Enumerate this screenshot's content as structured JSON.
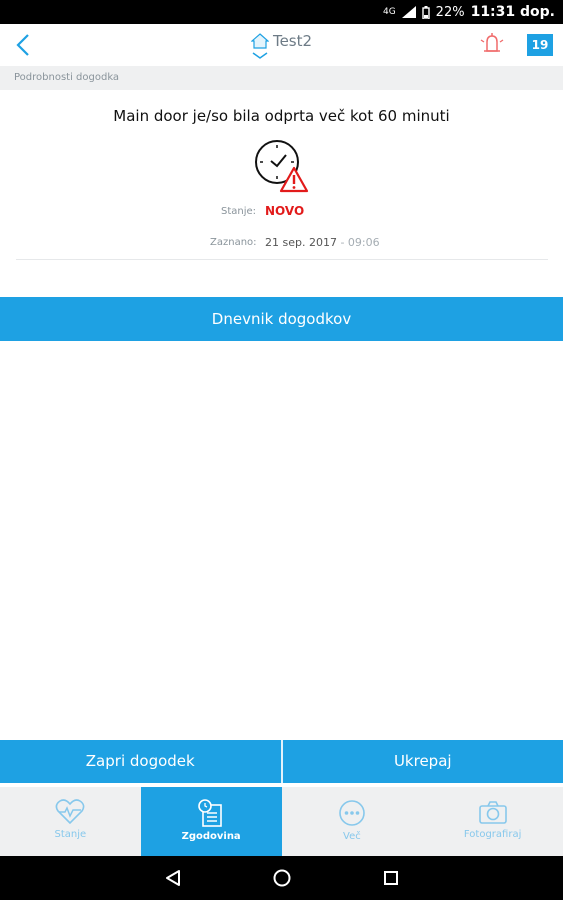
{
  "status_bar": {
    "network": "4G",
    "battery": "22%",
    "time": "11:31 dop."
  },
  "header": {
    "title": "Test2",
    "notification_count": "19",
    "icons": [
      "back-icon",
      "home-icon",
      "chevron-down-icon",
      "alarm-bell-icon"
    ]
  },
  "section": {
    "title": "Podrobnosti dogodka"
  },
  "event": {
    "title": "Main door je/so bila odprta več kot 60 minuti",
    "state_label": "Stanje:",
    "state_value": "NOVO",
    "detected_label": "Zaznano:",
    "detected_date": "21 sep. 2017",
    "detected_time": " - 09:06"
  },
  "log_button": "Dnevnik dogodkov",
  "actions": {
    "close": "Zapri dogodek",
    "act": "Ukrepaj"
  },
  "tabs": [
    {
      "label": "Stanje",
      "icon": "heart-pulse-icon"
    },
    {
      "label": "Zgodovina",
      "icon": "history-list-icon"
    },
    {
      "label": "Več",
      "icon": "more-icon"
    },
    {
      "label": "Fotografiraj",
      "icon": "camera-icon"
    }
  ],
  "colors": {
    "accent": "#1ea1e3",
    "alert": "#e21b1b",
    "tab_inactive": "#87c8ec"
  }
}
